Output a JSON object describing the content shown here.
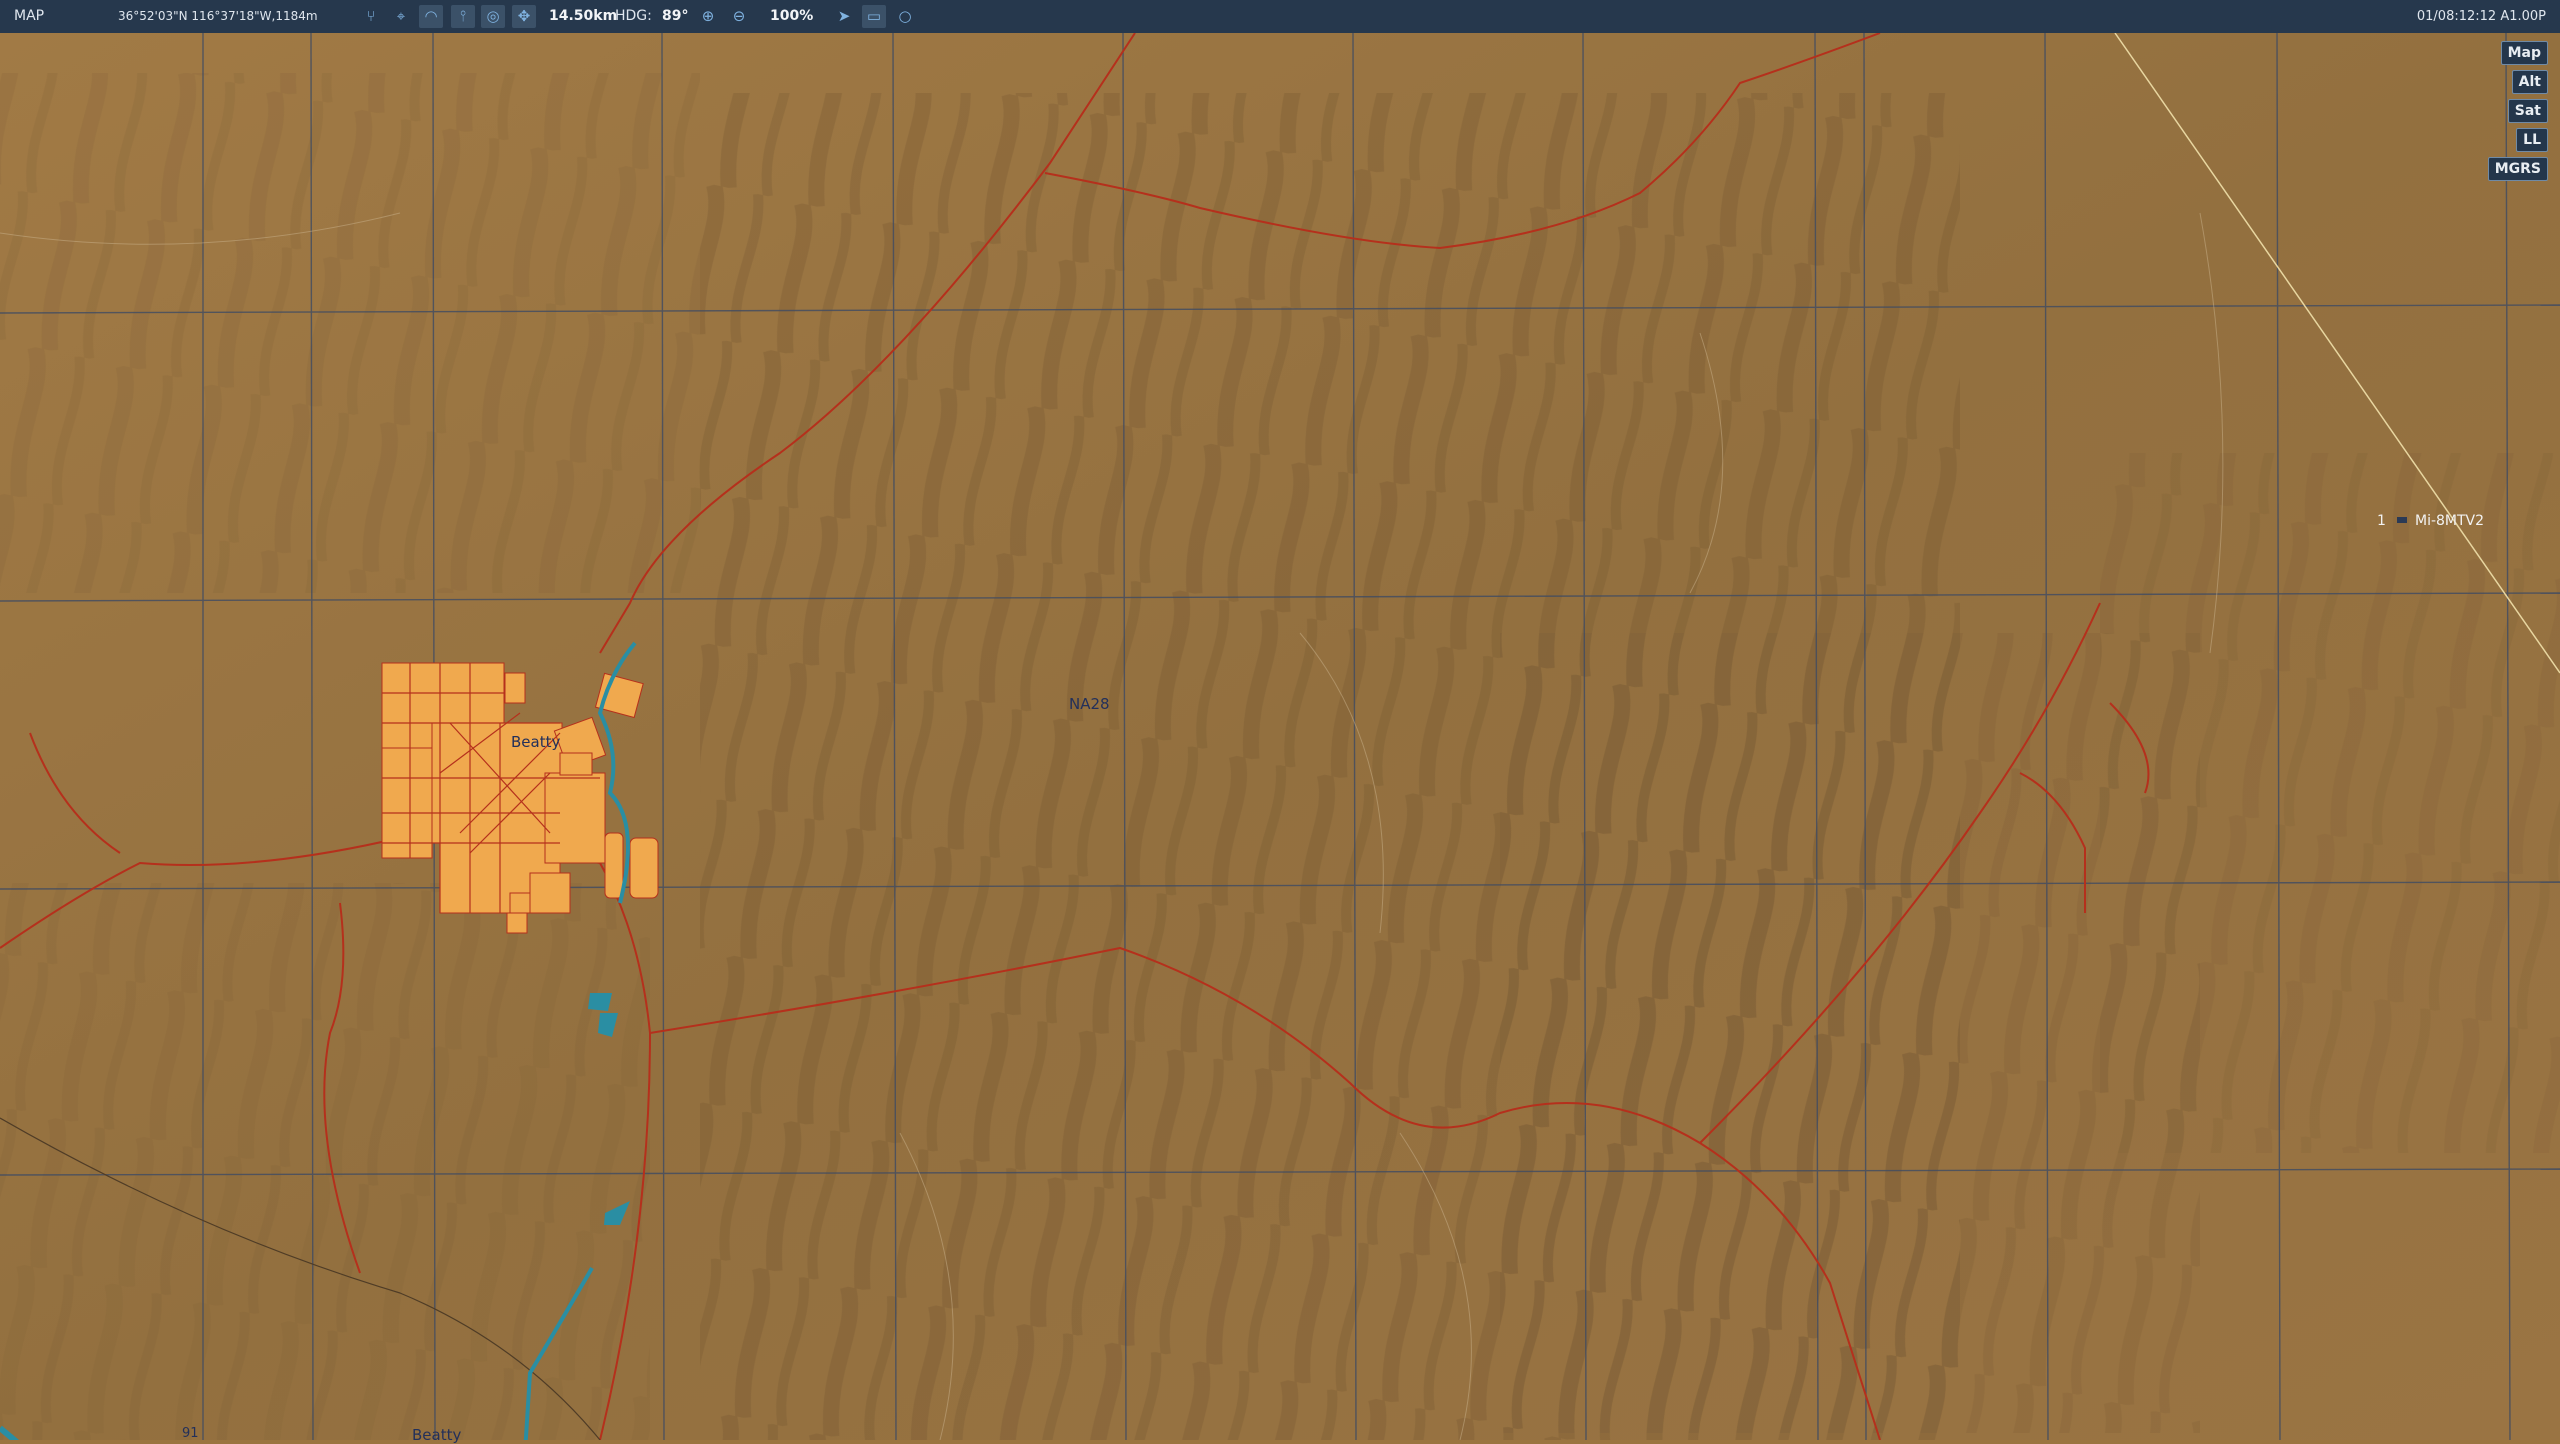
{
  "topbar": {
    "mode": "MAP",
    "coords": "36°52'03\"N 116°37'18\"W,1184m",
    "scale": "14.50km",
    "hdg_label": "HDG:",
    "hdg_value": "89°",
    "zoom": "100%",
    "datetime": "01/08:12:12 A1.00P"
  },
  "layers": {
    "map": "Map",
    "alt": "Alt",
    "sat": "Sat",
    "ll": "LL",
    "mgrs": "MGRS"
  },
  "map": {
    "town": "Beatty",
    "grid_label": "NA28",
    "bottom_label": "Beatty",
    "bottom_number": "91",
    "unit_number": "1",
    "unit_name": "Mi-8MTV2"
  },
  "colors": {
    "terrain": "#9b7440",
    "topbar": "#26384d",
    "road": "#b5301c",
    "town": "#f0a94e",
    "water": "#2a8ea3"
  }
}
